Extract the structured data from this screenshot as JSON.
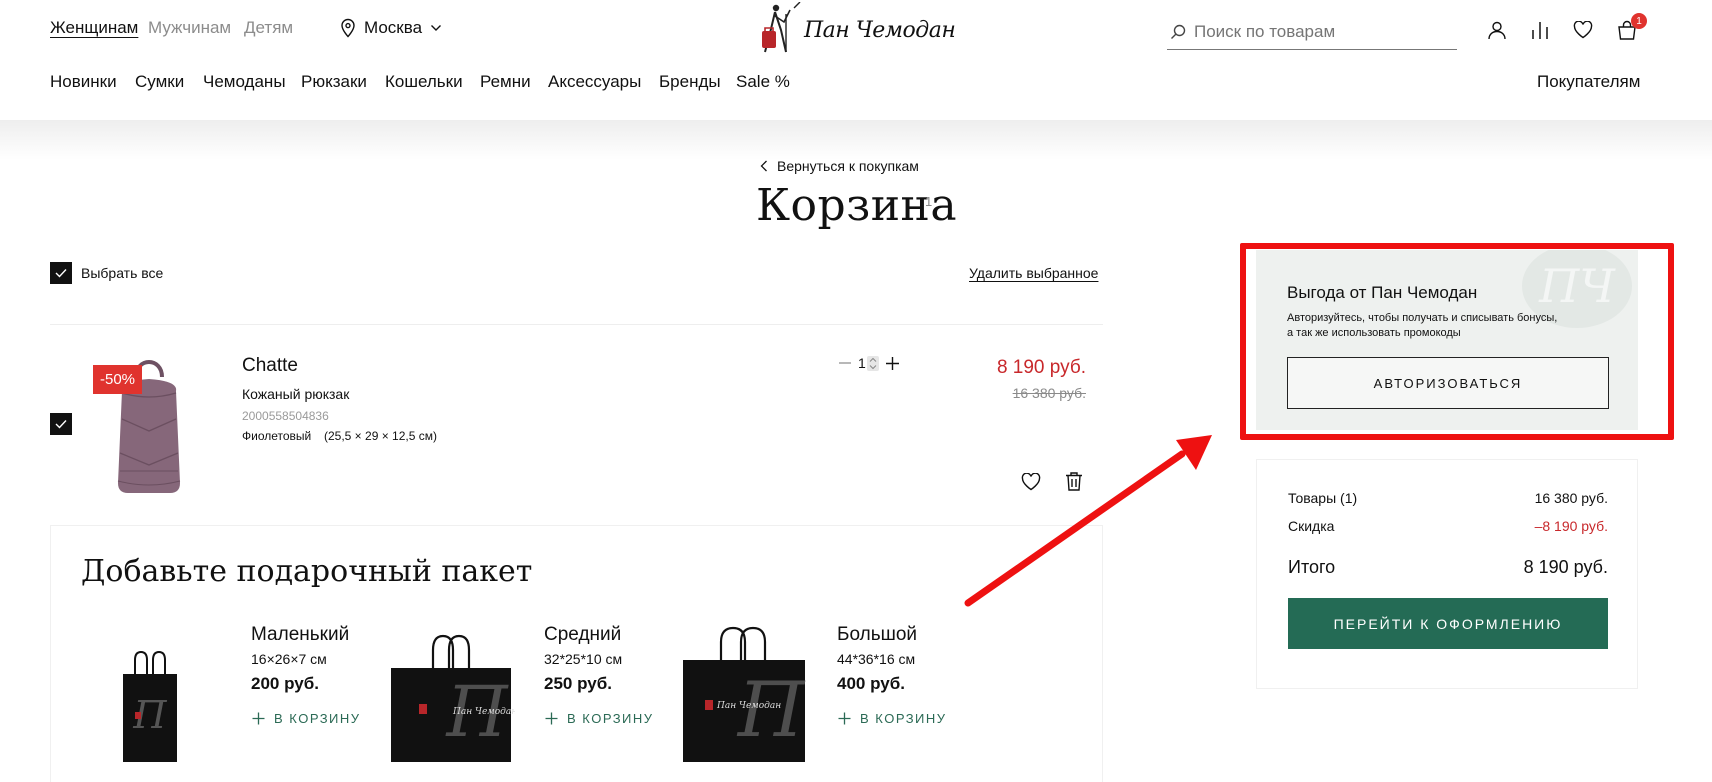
{
  "header": {
    "tabs": [
      {
        "label": "Женщинам",
        "active": true
      },
      {
        "label": "Мужчинам",
        "active": false
      },
      {
        "label": "Детям",
        "active": false
      }
    ],
    "city": "Москва",
    "logo_text": "Пан Чемодан",
    "search_placeholder": "Поиск по товарам",
    "cart_count": "1",
    "nav": [
      "Новинки",
      "Сумки",
      "Чемоданы",
      "Рюкзаки",
      "Кошельки",
      "Ремни",
      "Аксессуары",
      "Бренды",
      "Sale %"
    ],
    "buyers_link": "Покупателям"
  },
  "cart": {
    "back_link": "Вернуться к покупкам",
    "title": "Корзина",
    "count": "1",
    "select_all": "Выбрать все",
    "delete_selected": "Удалить выбранное",
    "item": {
      "discount_badge": "-50%",
      "name": "Chatte",
      "type": "Кожаный рюкзак",
      "sku": "2000558504836",
      "color": "Фиолетовый",
      "dimensions": "(25,5 × 29 × 12,5 см)",
      "quantity": "1",
      "price": "8 190 руб.",
      "old_price": "16 380 руб."
    }
  },
  "gift": {
    "title": "Добавьте подарочный пакет",
    "add_label": "В КОРЗИНУ",
    "bags": [
      {
        "name": "Маленький",
        "size": "16×26×7 см",
        "price": "200 руб."
      },
      {
        "name": "Средний",
        "size": "32*25*10 см",
        "price": "250 руб."
      },
      {
        "name": "Большой",
        "size": "44*36*16 см",
        "price": "400 руб."
      }
    ]
  },
  "benefit": {
    "title": "Выгода от Пан Чемодан",
    "text_line1": "Авторизуйтесь, чтобы получать и списывать бонусы,",
    "text_line2": "а так же использовать промокоды",
    "button": "АВТОРИЗОВАТЬСЯ",
    "watermark": "ПЧ"
  },
  "summary": {
    "goods_label": "Товары (1)",
    "goods_value": "16 380 руб.",
    "discount_label": "Скидка",
    "discount_value": "–8 190 руб.",
    "total_label": "Итого",
    "total_value": "8 190 руб.",
    "checkout_button": "ПЕРЕЙТИ К ОФОРМЛЕНИЮ"
  },
  "colors": {
    "accent_green": "#246b55",
    "price_red": "#c8282b",
    "badge_red": "#e0332e",
    "highlight_red": "#ee1111",
    "backpack_purple": "#86677a"
  }
}
